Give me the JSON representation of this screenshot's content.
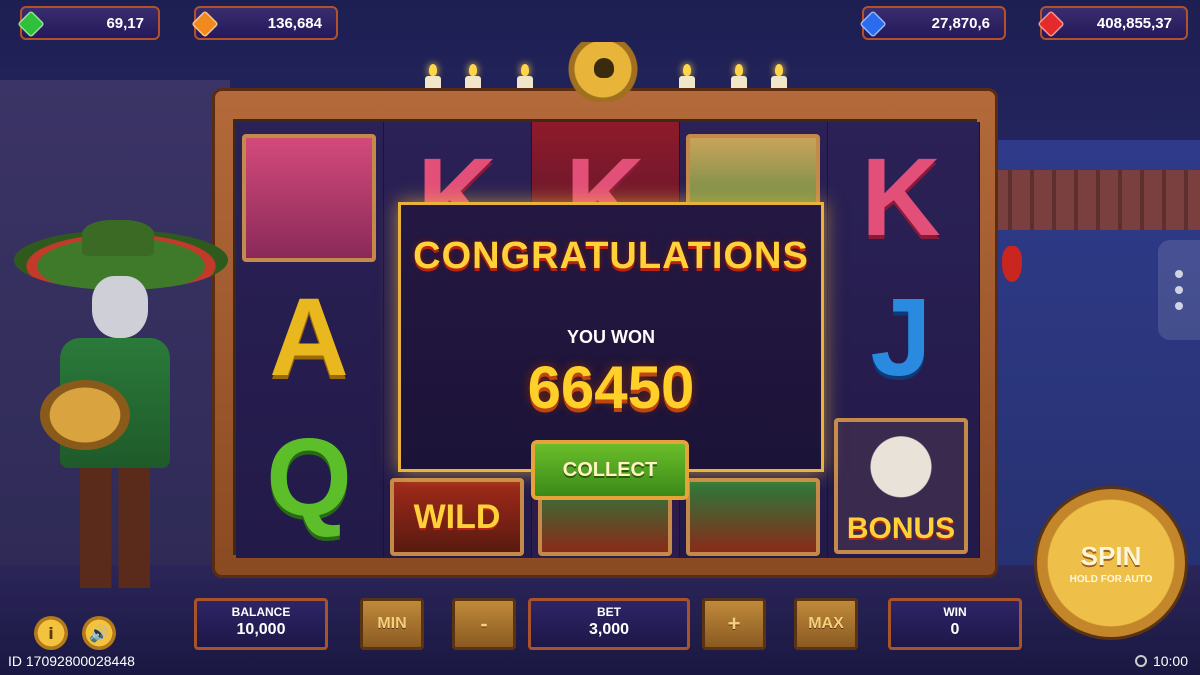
{
  "currencies": [
    {
      "id": "green",
      "value": "69,17",
      "color": "#2fbf3a"
    },
    {
      "id": "orange",
      "value": "136,684",
      "color": "#f08a1e"
    },
    {
      "id": "blue",
      "value": "27,870,6",
      "color": "#2a6cf0"
    },
    {
      "id": "red",
      "value": "408,855,37",
      "color": "#e42a2a"
    }
  ],
  "reels": [
    {
      "symbols": [
        "Skull lady portrait",
        "A",
        "Q"
      ]
    },
    {
      "symbols": [
        "K",
        "",
        "WILD"
      ]
    },
    {
      "symbols": [
        "K",
        "",
        "Mariachi"
      ]
    },
    {
      "symbols": [
        "Mariachi",
        "",
        "Mariachi"
      ]
    },
    {
      "symbols": [
        "K",
        "J",
        "BONUS"
      ]
    }
  ],
  "popup": {
    "title": "CONGRATULATIONS",
    "subtitle": "YOU WON",
    "amount": "66450",
    "collect_label": "COLLECT"
  },
  "controls": {
    "balance_label": "BALANCE",
    "balance_value": "10,000",
    "min_label": "MIN",
    "minus_label": "-",
    "bet_label": "BET",
    "bet_value": "3,000",
    "plus_label": "+",
    "max_label": "MAX",
    "win_label": "WIN",
    "win_value": "0",
    "spin_label": "SPIN",
    "spin_sub": "HOLD FOR AUTO"
  },
  "icons": {
    "info": "i",
    "sound": "🔊"
  },
  "footer": {
    "session_id": "ID 17092800028448",
    "time": "10:00"
  },
  "colors": {
    "accent": "#e9b23b",
    "frame": "#b46a3a",
    "collect_green": "#4ea21f"
  }
}
